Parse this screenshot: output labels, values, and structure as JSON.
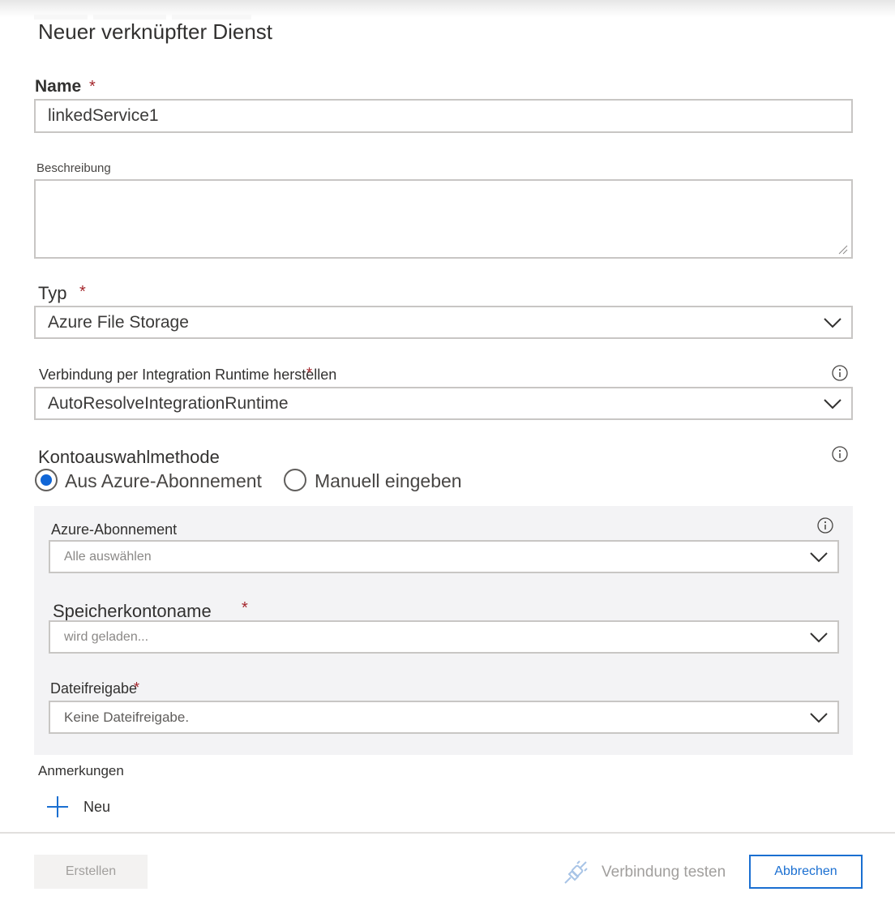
{
  "dialog": {
    "title": "Neuer verknüpfter Dienst"
  },
  "form": {
    "name": {
      "label": "Name",
      "required_mark": "*",
      "value": "linkedService1"
    },
    "description": {
      "label": "Beschreibung",
      "value": ""
    },
    "type": {
      "label": "Typ",
      "required_mark": "*",
      "value": "Azure File Storage"
    },
    "integration_runtime": {
      "label": "Verbindung per Integration Runtime herstellen",
      "required_mark": "*",
      "value": "AutoResolveIntegrationRuntime"
    },
    "account_selection": {
      "label": "Kontoauswahlmethode",
      "options": [
        "Aus Azure-Abonnement",
        "Manuell eingeben"
      ],
      "selected": "Aus Azure-Abonnement"
    },
    "subscription": {
      "label": "Azure-Abonnement",
      "value": "Alle auswählen"
    },
    "storage_account": {
      "label": "Speicherkontoname",
      "required_mark": "*",
      "value": "wird geladen..."
    },
    "file_share": {
      "label": "Dateifreigabe",
      "required_mark": "*",
      "value": "Keine Dateifreigabe."
    },
    "annotations": {
      "label": "Anmerkungen",
      "new_label": "Neu"
    }
  },
  "footer": {
    "create_label": "Erstellen",
    "test_connection_label": "Verbindung testen",
    "cancel_label": "Abbrechen"
  },
  "icons": {
    "chevron": "chevron-down-icon",
    "info": "info-icon",
    "plus": "plus-icon",
    "plug": "plug-icon"
  },
  "colors": {
    "accent": "#1a6fd1",
    "required": "#a4262c",
    "radio_selected": "#1066d6",
    "panel_bg": "#f3f3f5"
  }
}
